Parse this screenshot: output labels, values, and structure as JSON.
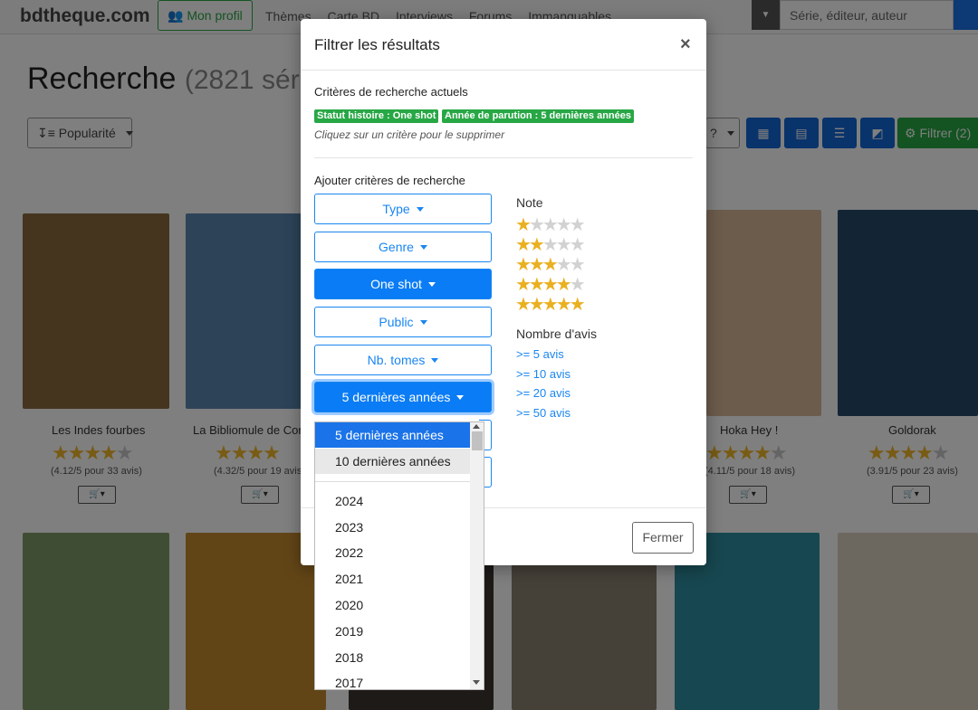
{
  "site": {
    "logo": "bdtheque.com",
    "profile_button": "Mon profil",
    "nav": [
      "Thèmes",
      "Carte BD",
      "Interviews",
      "Forums",
      "Immanquables"
    ],
    "search_placeholder": "Série, éditeur, auteur"
  },
  "results": {
    "title": "Recherche",
    "count": "(2821 sér",
    "sort_label": "Popularité",
    "help_label": "?",
    "filter_button": "Filtrer (2)"
  },
  "cards": [
    {
      "title": "Les Indes fourbes",
      "note": "(4.12/5 pour 33 avis)",
      "rating": 4,
      "cover_color": "#8a6b3e"
    },
    {
      "title": "La Bibliomule de Cor",
      "note": "(4.32/5 pour 19 avis",
      "rating": 4,
      "cover_color": "#5a86b0"
    },
    {
      "title": "Hoka Hey !",
      "note": "(4.11/5 pour 18 avis)",
      "rating": 4,
      "cover_color": "#d9b998"
    },
    {
      "title": "Goldorak",
      "note": "(3.91/5 pour 23 avis)",
      "rating": 4,
      "cover_color": "#27496b"
    }
  ],
  "modal": {
    "title": "Filtrer les résultats",
    "close_symbol": "×",
    "current_criteria_title": "Critères de recherche actuels",
    "badges": [
      "Statut histoire : One shot",
      "Année de parution : 5 dernières années"
    ],
    "hint": "Cliquez sur un critère pour le supprimer",
    "add_criteria_title": "Ajouter critères de recherche",
    "criteria_buttons": [
      {
        "label": "Type",
        "state": "normal"
      },
      {
        "label": "Genre",
        "state": "normal"
      },
      {
        "label": "One shot",
        "state": "active"
      },
      {
        "label": "Public",
        "state": "normal"
      },
      {
        "label": "Nb. tomes",
        "state": "normal"
      },
      {
        "label": "5 dernières années",
        "state": "focused"
      }
    ],
    "note_label": "Note",
    "ratings": [
      1,
      2,
      3,
      4,
      5
    ],
    "avis_label": "Nombre d'avis",
    "avis_links": [
      ">= 5 avis",
      ">= 10 avis",
      ">= 20 avis",
      ">= 50 avis"
    ],
    "close_button": "Fermer"
  },
  "dropdown": {
    "options": [
      "5 dernières années",
      "10 dernières années",
      "2024",
      "2023",
      "2022",
      "2021",
      "2020",
      "2019",
      "2018",
      "2017"
    ],
    "selected": "5 dernières années",
    "hovered": "10 dernières années"
  },
  "colors": {
    "accent_blue": "#1a86f0",
    "green": "#28a745",
    "star_gold": "#e9b020"
  }
}
